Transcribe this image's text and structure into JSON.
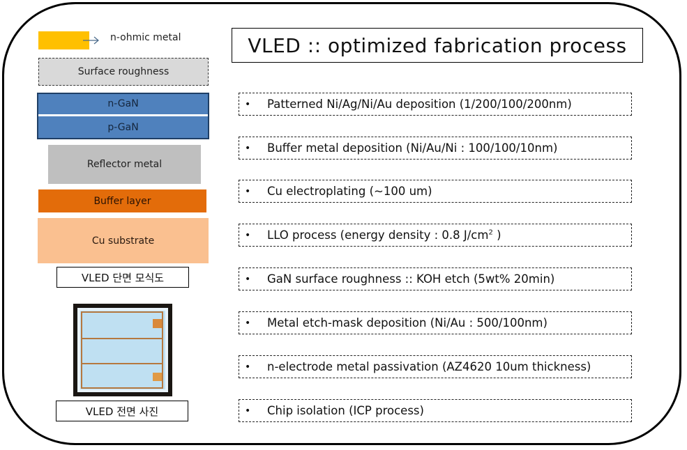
{
  "title": "VLED :: optimized  fabrication  process",
  "legend": {
    "ohmic_label": "n-ohmic  metal",
    "ohmic_color": "#FFC000"
  },
  "layers": {
    "surface": "Surface  roughness",
    "n_gan": "n-GaN",
    "p_gan": "p-GaN",
    "reflector": "Reflector  metal",
    "buffer": "Buffer  layer",
    "cu": "Cu substrate"
  },
  "colors": {
    "surface": "#D9D9D9",
    "gan": "#4F81BD",
    "reflector": "#BFBFBF",
    "buffer": "#E36C0A",
    "cu": "#FAC090"
  },
  "captions": {
    "cross_section": "VLED 단면 모식도",
    "front_photo": "VLED 전면 사진"
  },
  "steps": [
    {
      "bullet": "•",
      "text": "Patterned Ni/Ag/Ni/Au deposition (1/200/100/200nm)"
    },
    {
      "bullet": "•",
      "text": "Buffer metal deposition (Ni/Au/Ni : 100/100/10nm)"
    },
    {
      "bullet": "•",
      "text": "Cu electroplating (~100 um)"
    },
    {
      "bullet": "•",
      "text": "LLO process (energy density : 0.8 J/cm",
      "sup": "2",
      "after": " )"
    },
    {
      "bullet": "•",
      "text": "GaN surface roughness :: KOH etch (5wt% 20min)"
    },
    {
      "bullet": "•",
      "text": "Metal etch-mask deposition (Ni/Au : 500/100nm)"
    },
    {
      "bullet": "•",
      "text": "n-electrode metal passivation (AZ4620 10um thickness)"
    },
    {
      "bullet": "•",
      "text": "Chip isolation (ICP process)"
    }
  ]
}
